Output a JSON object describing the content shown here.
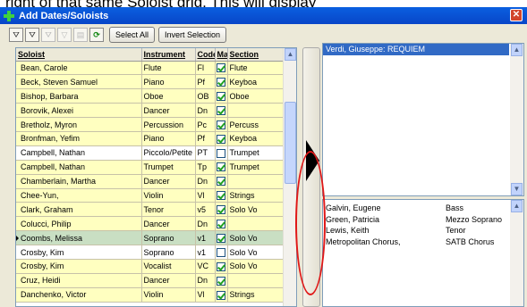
{
  "doc_text": "right of that same Soloist grid. This will display",
  "window": {
    "title": "Add Dates/Soloists",
    "close_glyph": "✕"
  },
  "toolbar": {
    "icons": [
      {
        "name": "filter-icon",
        "glyph": "⛛"
      },
      {
        "name": "filter-check-icon",
        "glyph": "⛛"
      },
      {
        "name": "filter-edit-icon",
        "glyph": "⛛"
      },
      {
        "name": "filter-clear-icon",
        "glyph": "▽"
      },
      {
        "name": "filter-lock-icon",
        "glyph": "▤"
      },
      {
        "name": "refresh-icon",
        "glyph": "⟳"
      }
    ],
    "select_all_label": "Select All",
    "invert_selection_label": "Invert Selection"
  },
  "grid": {
    "columns": [
      "Soloist",
      "Instrument",
      "Code",
      "Mark",
      "Section"
    ],
    "column_headers_display": [
      "Soloist",
      "Instrument",
      "Code",
      "Ma",
      "Section"
    ],
    "rows": [
      {
        "soloist": "Bean, Carole",
        "instrument": "Flute",
        "code": "Fl",
        "checked": true,
        "section": "Flute",
        "style": "yellow"
      },
      {
        "soloist": "Beck, Steven Samuel",
        "instrument": "Piano",
        "code": "Pf",
        "checked": true,
        "section": "Keyboa",
        "style": "yellow"
      },
      {
        "soloist": "Bishop, Barbara",
        "instrument": "Oboe",
        "code": "OB",
        "checked": true,
        "section": "Oboe",
        "style": "yellow"
      },
      {
        "soloist": "Borovik, Alexei",
        "instrument": "Dancer",
        "code": "Dn",
        "checked": true,
        "section": "",
        "style": "yellow"
      },
      {
        "soloist": "Bretholz, Myron",
        "instrument": "Percussion",
        "code": "Pc",
        "checked": true,
        "section": "Percuss",
        "style": "yellow"
      },
      {
        "soloist": "Bronfman, Yefim",
        "instrument": "Piano",
        "code": "Pf",
        "checked": true,
        "section": "Keyboa",
        "style": "yellow"
      },
      {
        "soloist": "Campbell, Nathan",
        "instrument": "Piccolo/Petite",
        "code": "PT",
        "checked": false,
        "section": "Trumpet",
        "style": "plain"
      },
      {
        "soloist": "Campbell, Nathan",
        "instrument": "Trumpet",
        "code": "Tp",
        "checked": true,
        "section": "Trumpet",
        "style": "yellow"
      },
      {
        "soloist": "Chamberlain, Martha",
        "instrument": "Dancer",
        "code": "Dn",
        "checked": true,
        "section": "",
        "style": "yellow"
      },
      {
        "soloist": "Chee-Yun,",
        "instrument": "Violin",
        "code": "Vl",
        "checked": true,
        "section": "Strings",
        "style": "yellow"
      },
      {
        "soloist": "Clark, Graham",
        "instrument": "Tenor",
        "code": "v5",
        "checked": true,
        "section": "Solo Vo",
        "style": "yellow"
      },
      {
        "soloist": "Colucci, Philip",
        "instrument": "Dancer",
        "code": "Dn",
        "checked": true,
        "section": "",
        "style": "yellow"
      },
      {
        "soloist": "Coombs, Melissa",
        "instrument": "Soprano",
        "code": "v1",
        "checked": true,
        "section": "Solo Vo",
        "style": "selected"
      },
      {
        "soloist": "Crosby, Kim",
        "instrument": "Soprano",
        "code": "v1",
        "checked": false,
        "section": "Solo Vo",
        "style": "plain"
      },
      {
        "soloist": "Crosby, Kim",
        "instrument": "Vocalist",
        "code": "VC",
        "checked": true,
        "section": "Solo Vo",
        "style": "yellow"
      },
      {
        "soloist": "Cruz, Heidi",
        "instrument": "Dancer",
        "code": "Dn",
        "checked": true,
        "section": "",
        "style": "yellow"
      },
      {
        "soloist": "Danchenko, Victor",
        "instrument": "Violin",
        "code": "Vl",
        "checked": true,
        "section": "Strings",
        "style": "yellow"
      }
    ]
  },
  "transfer": {
    "arrow_name": "transfer-right-arrow"
  },
  "works_list": {
    "items": [
      "Verdi, Giuseppe: REQUIEM"
    ]
  },
  "assigned_list": {
    "items": [
      {
        "name": "Galvin, Eugene",
        "voice": "Bass"
      },
      {
        "name": "Green, Patricia",
        "voice": "Mezzo Soprano"
      },
      {
        "name": "Lewis, Keith",
        "voice": "Tenor"
      },
      {
        "name": "Metropolitan Chorus,",
        "voice": "SATB Chorus"
      }
    ]
  },
  "colors": {
    "title_bar": "#0846c8",
    "row_highlight": "#ffffc0",
    "row_selected": "#c9dfc3",
    "annotation": "#e01818"
  }
}
